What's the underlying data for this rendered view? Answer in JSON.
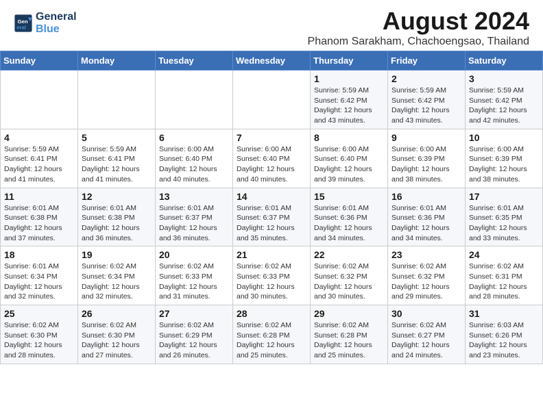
{
  "logo": {
    "line1": "General",
    "line2": "Blue"
  },
  "title": "August 2024",
  "subtitle": "Phanom Sarakham, Chachoengsao, Thailand",
  "days_of_week": [
    "Sunday",
    "Monday",
    "Tuesday",
    "Wednesday",
    "Thursday",
    "Friday",
    "Saturday"
  ],
  "weeks": [
    [
      {
        "num": "",
        "detail": ""
      },
      {
        "num": "",
        "detail": ""
      },
      {
        "num": "",
        "detail": ""
      },
      {
        "num": "",
        "detail": ""
      },
      {
        "num": "1",
        "detail": "Sunrise: 5:59 AM\nSunset: 6:42 PM\nDaylight: 12 hours\nand 43 minutes."
      },
      {
        "num": "2",
        "detail": "Sunrise: 5:59 AM\nSunset: 6:42 PM\nDaylight: 12 hours\nand 43 minutes."
      },
      {
        "num": "3",
        "detail": "Sunrise: 5:59 AM\nSunset: 6:42 PM\nDaylight: 12 hours\nand 42 minutes."
      }
    ],
    [
      {
        "num": "4",
        "detail": "Sunrise: 5:59 AM\nSunset: 6:41 PM\nDaylight: 12 hours\nand 41 minutes."
      },
      {
        "num": "5",
        "detail": "Sunrise: 5:59 AM\nSunset: 6:41 PM\nDaylight: 12 hours\nand 41 minutes."
      },
      {
        "num": "6",
        "detail": "Sunrise: 6:00 AM\nSunset: 6:40 PM\nDaylight: 12 hours\nand 40 minutes."
      },
      {
        "num": "7",
        "detail": "Sunrise: 6:00 AM\nSunset: 6:40 PM\nDaylight: 12 hours\nand 40 minutes."
      },
      {
        "num": "8",
        "detail": "Sunrise: 6:00 AM\nSunset: 6:40 PM\nDaylight: 12 hours\nand 39 minutes."
      },
      {
        "num": "9",
        "detail": "Sunrise: 6:00 AM\nSunset: 6:39 PM\nDaylight: 12 hours\nand 38 minutes."
      },
      {
        "num": "10",
        "detail": "Sunrise: 6:00 AM\nSunset: 6:39 PM\nDaylight: 12 hours\nand 38 minutes."
      }
    ],
    [
      {
        "num": "11",
        "detail": "Sunrise: 6:01 AM\nSunset: 6:38 PM\nDaylight: 12 hours\nand 37 minutes."
      },
      {
        "num": "12",
        "detail": "Sunrise: 6:01 AM\nSunset: 6:38 PM\nDaylight: 12 hours\nand 36 minutes."
      },
      {
        "num": "13",
        "detail": "Sunrise: 6:01 AM\nSunset: 6:37 PM\nDaylight: 12 hours\nand 36 minutes."
      },
      {
        "num": "14",
        "detail": "Sunrise: 6:01 AM\nSunset: 6:37 PM\nDaylight: 12 hours\nand 35 minutes."
      },
      {
        "num": "15",
        "detail": "Sunrise: 6:01 AM\nSunset: 6:36 PM\nDaylight: 12 hours\nand 34 minutes."
      },
      {
        "num": "16",
        "detail": "Sunrise: 6:01 AM\nSunset: 6:36 PM\nDaylight: 12 hours\nand 34 minutes."
      },
      {
        "num": "17",
        "detail": "Sunrise: 6:01 AM\nSunset: 6:35 PM\nDaylight: 12 hours\nand 33 minutes."
      }
    ],
    [
      {
        "num": "18",
        "detail": "Sunrise: 6:01 AM\nSunset: 6:34 PM\nDaylight: 12 hours\nand 32 minutes."
      },
      {
        "num": "19",
        "detail": "Sunrise: 6:02 AM\nSunset: 6:34 PM\nDaylight: 12 hours\nand 32 minutes."
      },
      {
        "num": "20",
        "detail": "Sunrise: 6:02 AM\nSunset: 6:33 PM\nDaylight: 12 hours\nand 31 minutes."
      },
      {
        "num": "21",
        "detail": "Sunrise: 6:02 AM\nSunset: 6:33 PM\nDaylight: 12 hours\nand 30 minutes."
      },
      {
        "num": "22",
        "detail": "Sunrise: 6:02 AM\nSunset: 6:32 PM\nDaylight: 12 hours\nand 30 minutes."
      },
      {
        "num": "23",
        "detail": "Sunrise: 6:02 AM\nSunset: 6:32 PM\nDaylight: 12 hours\nand 29 minutes."
      },
      {
        "num": "24",
        "detail": "Sunrise: 6:02 AM\nSunset: 6:31 PM\nDaylight: 12 hours\nand 28 minutes."
      }
    ],
    [
      {
        "num": "25",
        "detail": "Sunrise: 6:02 AM\nSunset: 6:30 PM\nDaylight: 12 hours\nand 28 minutes."
      },
      {
        "num": "26",
        "detail": "Sunrise: 6:02 AM\nSunset: 6:30 PM\nDaylight: 12 hours\nand 27 minutes."
      },
      {
        "num": "27",
        "detail": "Sunrise: 6:02 AM\nSunset: 6:29 PM\nDaylight: 12 hours\nand 26 minutes."
      },
      {
        "num": "28",
        "detail": "Sunrise: 6:02 AM\nSunset: 6:28 PM\nDaylight: 12 hours\nand 25 minutes."
      },
      {
        "num": "29",
        "detail": "Sunrise: 6:02 AM\nSunset: 6:28 PM\nDaylight: 12 hours\nand 25 minutes."
      },
      {
        "num": "30",
        "detail": "Sunrise: 6:02 AM\nSunset: 6:27 PM\nDaylight: 12 hours\nand 24 minutes."
      },
      {
        "num": "31",
        "detail": "Sunrise: 6:03 AM\nSunset: 6:26 PM\nDaylight: 12 hours\nand 23 minutes."
      }
    ]
  ]
}
